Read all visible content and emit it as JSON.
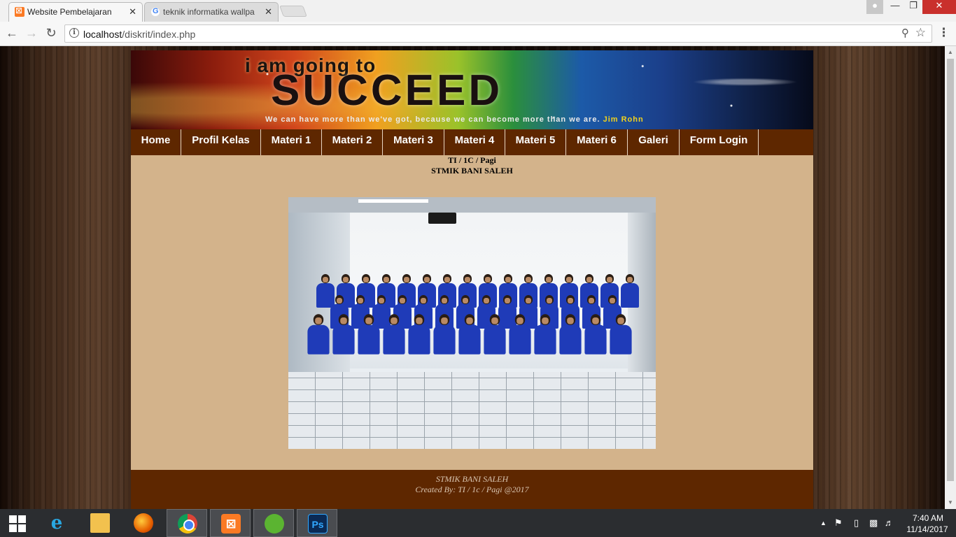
{
  "browser": {
    "tabs": [
      {
        "title": "Website Pembelajaran",
        "active": true,
        "icon": "xampp-icon"
      },
      {
        "title": "teknik informatika wallpa",
        "active": false,
        "icon": "google-icon"
      }
    ],
    "address": {
      "host": "localhost",
      "path": "/diskrit/index.php"
    }
  },
  "page": {
    "banner": {
      "line1": "i am going to",
      "line2": "SUCCEED",
      "quote": "We can have more than we've got, because we can become more than we are.",
      "author": "Jim Rohn"
    },
    "nav": {
      "items": [
        "Home",
        "Profil Kelas",
        "Materi 1",
        "Materi 2",
        "Materi 3",
        "Materi 4",
        "Materi 5",
        "Materi 6",
        "Galeri",
        "Form Login"
      ]
    },
    "subtitle": {
      "line1": "TI / 1C / Pagi",
      "line2": "STMIK BANI SALEH"
    },
    "footer": {
      "line1": "STMIK BANI SALEH",
      "line2": "Created By: TI / 1c / Pagi @2017"
    }
  },
  "taskbar": {
    "apps": [
      "internet-explorer-icon",
      "file-explorer-icon",
      "firefox-icon",
      "chrome-icon",
      "xampp-icon",
      "dreamweaver-icon",
      "photoshop-icon"
    ],
    "ps_label": "Ps",
    "clock": {
      "time": "7:40 AM",
      "date": "11/14/2017"
    }
  },
  "colors": {
    "nav_bg": "#5e2700",
    "content_bg": "#d3b38b",
    "footer_text": "#d9c5b0"
  }
}
